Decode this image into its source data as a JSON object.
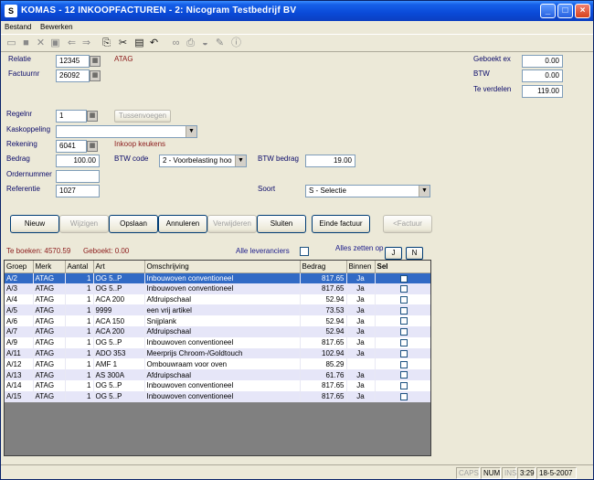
{
  "window": {
    "title": "KOMAS - 12 INKOOPFACTUREN - 2: Nicogram Testbedrijf BV",
    "minimize": "_",
    "maximize": "□",
    "close": "×"
  },
  "menu": {
    "file": "Bestand",
    "edit": "Bewerken"
  },
  "toolbar": [
    "new-icon",
    "save-icon",
    "delete-icon",
    "saveas-icon",
    "back-arrow-icon",
    "forward-arrow-icon",
    "copy-icon",
    "cut-icon",
    "paste-icon",
    "undo-icon",
    "binoculars-icon",
    "print-icon",
    "preview-icon",
    "edit-icon",
    "info-icon"
  ],
  "header": {
    "relatie_label": "Relatie",
    "relatie_value": "12345",
    "relatie_name": "ATAG",
    "factuur_label": "Factuurnr",
    "factuur_value": "26092",
    "geboekt_label": "Geboekt ex",
    "geboekt_value": "0.00",
    "btw_label": "BTW",
    "btw_value": "0.00",
    "verdelen_label": "Te verdelen",
    "verdelen_value": "119.00"
  },
  "line": {
    "regelnr_label": "Regelnr",
    "regelnr_value": "1",
    "tussenvoegen": "Tussenvoegen",
    "kaskoppeling_label": "Kaskoppeling",
    "kaskoppeling_value": "",
    "rekening_label": "Rekening",
    "rekening_value": "6041",
    "rekening_name": "Inkoop keukens",
    "bedrag_label": "Bedrag",
    "bedrag_value": "100.00",
    "btwcode_label": "BTW code",
    "btwcode_value": "2 - Voorbelasting hoo",
    "btwbedrag_label": "BTW bedrag",
    "btwbedrag_value": "19.00",
    "ordernummer_label": "Ordernummer",
    "ordernummer_value": "",
    "referentie_label": "Referentie",
    "referentie_value": "1027",
    "soort_label": "Soort",
    "soort_value": "S - Selectie"
  },
  "buttons": {
    "nieuw": "Nieuw",
    "wijzigen": "Wijzigen",
    "opslaan": "Opslaan",
    "annuleren": "Annuleren",
    "verwijderen": "Verwijderen",
    "sluiten": "Sluiten",
    "einde": "Einde factuur",
    "factuur": "<Factuur"
  },
  "summary": {
    "te_boeken": "Te boeken: 4570.59",
    "geboekt": "Geboekt: 0.00",
    "alle_lev": "Alle leveranciers",
    "alles_zetten": "Alles zetten op",
    "j": "J",
    "n": "N"
  },
  "table": {
    "columns": [
      "Groep",
      "Merk",
      "Aantal",
      "Art",
      "Omschrijving",
      "Bedrag",
      "Binnen",
      "Sel"
    ],
    "rows": [
      [
        "A/2",
        "ATAG",
        "1",
        "OG 5..P",
        "Inbouwoven conventioneel",
        "817.65",
        "Ja",
        ""
      ],
      [
        "A/3",
        "ATAG",
        "1",
        "OG 5..P",
        "Inbouwoven conventioneel",
        "817.65",
        "Ja",
        ""
      ],
      [
        "A/4",
        "ATAG",
        "1",
        "ACA 200",
        "Afdruipschaal",
        "52.94",
        "Ja",
        ""
      ],
      [
        "A/5",
        "ATAG",
        "1",
        "9999",
        "een vrij artikel",
        "73.53",
        "Ja",
        ""
      ],
      [
        "A/6",
        "ATAG",
        "1",
        "ACA 150",
        "Snijplank",
        "52.94",
        "Ja",
        ""
      ],
      [
        "A/7",
        "ATAG",
        "1",
        "ACA 200",
        "Afdruipschaal",
        "52.94",
        "Ja",
        ""
      ],
      [
        "A/9",
        "ATAG",
        "1",
        "OG 5..P",
        "Inbouwoven conventioneel",
        "817.65",
        "Ja",
        ""
      ],
      [
        "A/11",
        "ATAG",
        "1",
        "ADO 353",
        "Meerprijs Chroom-/Goldtouch",
        "102.94",
        "Ja",
        ""
      ],
      [
        "A/12",
        "ATAG",
        "1",
        "AMF 1",
        "Ombouwraam voor oven",
        "85.29",
        "",
        ""
      ],
      [
        "A/13",
        "ATAG",
        "1",
        "AS 300A",
        "Afdruipschaal",
        "61.76",
        "Ja",
        ""
      ],
      [
        "A/14",
        "ATAG",
        "1",
        "OG 5..P",
        "Inbouwoven conventioneel",
        "817.65",
        "Ja",
        ""
      ],
      [
        "A/15",
        "ATAG",
        "1",
        "OG 5..P",
        "Inbouwoven conventioneel",
        "817.65",
        "Ja",
        ""
      ]
    ]
  },
  "status": {
    "caps": "CAPS",
    "num": "NUM",
    "ins": "INS",
    "time": "3:29",
    "date": "18-5-2007"
  }
}
